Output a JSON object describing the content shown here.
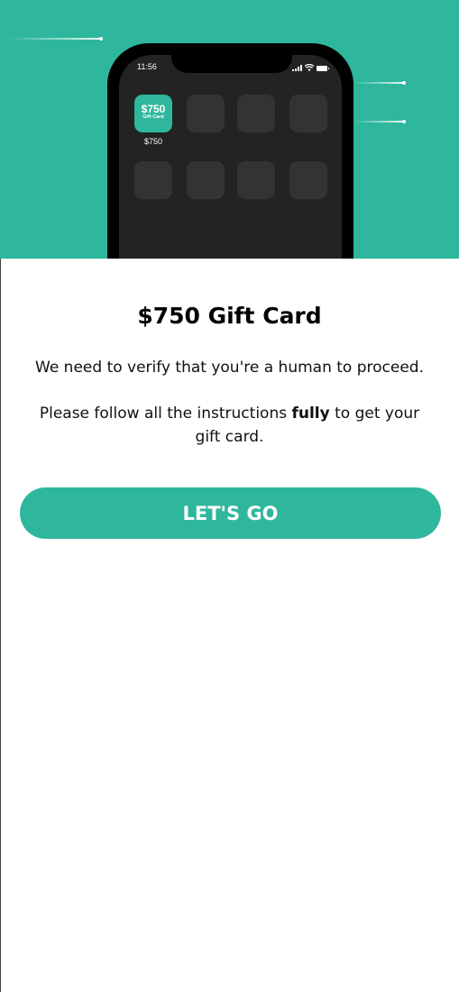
{
  "colors": {
    "accent": "#2fb79d",
    "phone_screen": "#232323",
    "app_tile": "#333333"
  },
  "phone": {
    "time": "11:56",
    "gift_app": {
      "amount": "$750",
      "subtitle": "Gift Card",
      "label": "$750"
    },
    "status_icons": [
      "signal-icon",
      "wifi-icon",
      "battery-icon"
    ]
  },
  "content": {
    "title": "$750 Gift Card",
    "verify_text": "We need to verify that you're a human to proceed.",
    "instructions_before": "Please follow all the instructions ",
    "instructions_bold": "fully",
    "instructions_after": " to get your gift card.",
    "button_label": "LET'S GO"
  }
}
